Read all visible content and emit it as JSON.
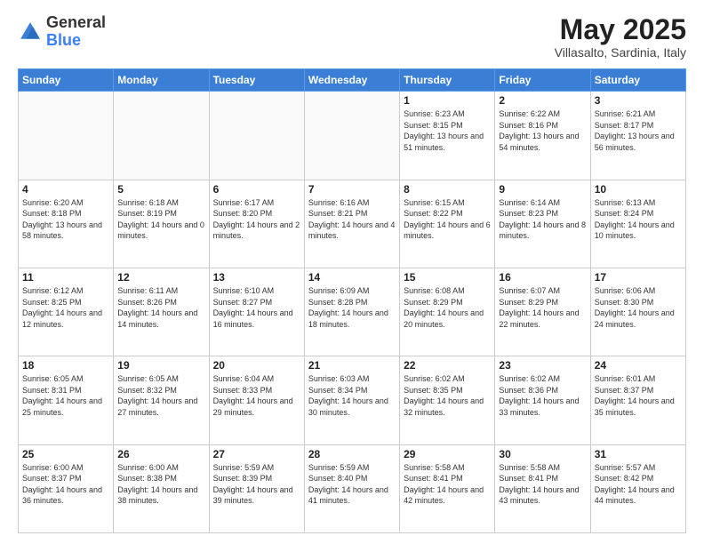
{
  "header": {
    "logo_general": "General",
    "logo_blue": "Blue",
    "month_title": "May 2025",
    "subtitle": "Villasalto, Sardinia, Italy"
  },
  "days_of_week": [
    "Sunday",
    "Monday",
    "Tuesday",
    "Wednesday",
    "Thursday",
    "Friday",
    "Saturday"
  ],
  "weeks": [
    [
      {
        "day": "",
        "info": ""
      },
      {
        "day": "",
        "info": ""
      },
      {
        "day": "",
        "info": ""
      },
      {
        "day": "",
        "info": ""
      },
      {
        "day": "1",
        "info": "Sunrise: 6:23 AM\nSunset: 8:15 PM\nDaylight: 13 hours and 51 minutes."
      },
      {
        "day": "2",
        "info": "Sunrise: 6:22 AM\nSunset: 8:16 PM\nDaylight: 13 hours and 54 minutes."
      },
      {
        "day": "3",
        "info": "Sunrise: 6:21 AM\nSunset: 8:17 PM\nDaylight: 13 hours and 56 minutes."
      }
    ],
    [
      {
        "day": "4",
        "info": "Sunrise: 6:20 AM\nSunset: 8:18 PM\nDaylight: 13 hours and 58 minutes."
      },
      {
        "day": "5",
        "info": "Sunrise: 6:18 AM\nSunset: 8:19 PM\nDaylight: 14 hours and 0 minutes."
      },
      {
        "day": "6",
        "info": "Sunrise: 6:17 AM\nSunset: 8:20 PM\nDaylight: 14 hours and 2 minutes."
      },
      {
        "day": "7",
        "info": "Sunrise: 6:16 AM\nSunset: 8:21 PM\nDaylight: 14 hours and 4 minutes."
      },
      {
        "day": "8",
        "info": "Sunrise: 6:15 AM\nSunset: 8:22 PM\nDaylight: 14 hours and 6 minutes."
      },
      {
        "day": "9",
        "info": "Sunrise: 6:14 AM\nSunset: 8:23 PM\nDaylight: 14 hours and 8 minutes."
      },
      {
        "day": "10",
        "info": "Sunrise: 6:13 AM\nSunset: 8:24 PM\nDaylight: 14 hours and 10 minutes."
      }
    ],
    [
      {
        "day": "11",
        "info": "Sunrise: 6:12 AM\nSunset: 8:25 PM\nDaylight: 14 hours and 12 minutes."
      },
      {
        "day": "12",
        "info": "Sunrise: 6:11 AM\nSunset: 8:26 PM\nDaylight: 14 hours and 14 minutes."
      },
      {
        "day": "13",
        "info": "Sunrise: 6:10 AM\nSunset: 8:27 PM\nDaylight: 14 hours and 16 minutes."
      },
      {
        "day": "14",
        "info": "Sunrise: 6:09 AM\nSunset: 8:28 PM\nDaylight: 14 hours and 18 minutes."
      },
      {
        "day": "15",
        "info": "Sunrise: 6:08 AM\nSunset: 8:29 PM\nDaylight: 14 hours and 20 minutes."
      },
      {
        "day": "16",
        "info": "Sunrise: 6:07 AM\nSunset: 8:29 PM\nDaylight: 14 hours and 22 minutes."
      },
      {
        "day": "17",
        "info": "Sunrise: 6:06 AM\nSunset: 8:30 PM\nDaylight: 14 hours and 24 minutes."
      }
    ],
    [
      {
        "day": "18",
        "info": "Sunrise: 6:05 AM\nSunset: 8:31 PM\nDaylight: 14 hours and 25 minutes."
      },
      {
        "day": "19",
        "info": "Sunrise: 6:05 AM\nSunset: 8:32 PM\nDaylight: 14 hours and 27 minutes."
      },
      {
        "day": "20",
        "info": "Sunrise: 6:04 AM\nSunset: 8:33 PM\nDaylight: 14 hours and 29 minutes."
      },
      {
        "day": "21",
        "info": "Sunrise: 6:03 AM\nSunset: 8:34 PM\nDaylight: 14 hours and 30 minutes."
      },
      {
        "day": "22",
        "info": "Sunrise: 6:02 AM\nSunset: 8:35 PM\nDaylight: 14 hours and 32 minutes."
      },
      {
        "day": "23",
        "info": "Sunrise: 6:02 AM\nSunset: 8:36 PM\nDaylight: 14 hours and 33 minutes."
      },
      {
        "day": "24",
        "info": "Sunrise: 6:01 AM\nSunset: 8:37 PM\nDaylight: 14 hours and 35 minutes."
      }
    ],
    [
      {
        "day": "25",
        "info": "Sunrise: 6:00 AM\nSunset: 8:37 PM\nDaylight: 14 hours and 36 minutes."
      },
      {
        "day": "26",
        "info": "Sunrise: 6:00 AM\nSunset: 8:38 PM\nDaylight: 14 hours and 38 minutes."
      },
      {
        "day": "27",
        "info": "Sunrise: 5:59 AM\nSunset: 8:39 PM\nDaylight: 14 hours and 39 minutes."
      },
      {
        "day": "28",
        "info": "Sunrise: 5:59 AM\nSunset: 8:40 PM\nDaylight: 14 hours and 41 minutes."
      },
      {
        "day": "29",
        "info": "Sunrise: 5:58 AM\nSunset: 8:41 PM\nDaylight: 14 hours and 42 minutes."
      },
      {
        "day": "30",
        "info": "Sunrise: 5:58 AM\nSunset: 8:41 PM\nDaylight: 14 hours and 43 minutes."
      },
      {
        "day": "31",
        "info": "Sunrise: 5:57 AM\nSunset: 8:42 PM\nDaylight: 14 hours and 44 minutes."
      }
    ]
  ]
}
